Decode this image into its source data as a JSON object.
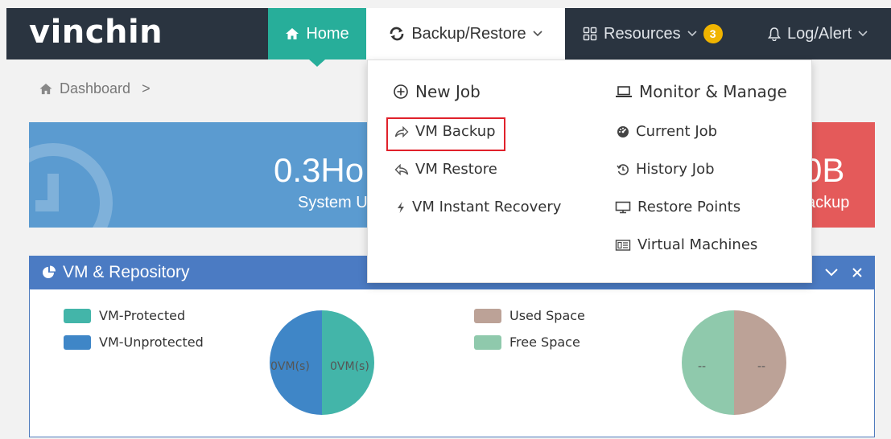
{
  "brand": {
    "logo_text": "vinchin"
  },
  "nav": {
    "home": "Home",
    "backup_restore": "Backup/Restore",
    "resources": "Resources",
    "resources_badge": "3",
    "log_alert": "Log/Alert"
  },
  "breadcrumb": {
    "label": "Dashboard",
    "separator": ">"
  },
  "stats": {
    "system": {
      "value": "0.3Ho",
      "label": "System U"
    },
    "backup": {
      "value": "0B",
      "label": "ackup"
    }
  },
  "dropdown": {
    "left": [
      {
        "key": "new_job",
        "label": "New Job",
        "icon": "plus-circle-icon"
      },
      {
        "key": "vm_backup",
        "label": "VM Backup",
        "icon": "share-arrow-icon",
        "highlighted": true
      },
      {
        "key": "vm_restore",
        "label": "VM Restore",
        "icon": "reply-icon"
      },
      {
        "key": "vm_instant_recovery",
        "label": "VM Instant Recovery",
        "icon": "bolt-icon"
      }
    ],
    "right": [
      {
        "key": "monitor_manage",
        "label": "Monitor & Manage",
        "icon": "laptop-icon"
      },
      {
        "key": "current_job",
        "label": "Current Job",
        "icon": "dashboard-icon"
      },
      {
        "key": "history_job",
        "label": "History Job",
        "icon": "history-icon"
      },
      {
        "key": "restore_points",
        "label": "Restore Points",
        "icon": "desktop-icon"
      },
      {
        "key": "virtual_machines",
        "label": "Virtual Machines",
        "icon": "server-icon"
      }
    ]
  },
  "panel": {
    "title": "VM & Repository",
    "vm_legend": [
      {
        "label": "VM-Protected",
        "color": "#43b5a9"
      },
      {
        "label": "VM-Unprotected",
        "color": "#3f86c7"
      }
    ],
    "vm_pie_labels": {
      "left": "0VM(s)",
      "right": "0VM(s)"
    },
    "repo_legend": [
      {
        "label": "Used Space",
        "color": "#bca297"
      },
      {
        "label": "Free Space",
        "color": "#8fc9ac"
      }
    ],
    "repo_pie_labels": {
      "left": "--",
      "right": "--"
    }
  },
  "colors": {
    "topbar": "#2a3440",
    "home_active": "#27ae9a",
    "panel_header": "#4b7bc3",
    "stat_blue": "#5b9bd0",
    "stat_red": "#e45a5a",
    "highlight": "#e0212b"
  }
}
